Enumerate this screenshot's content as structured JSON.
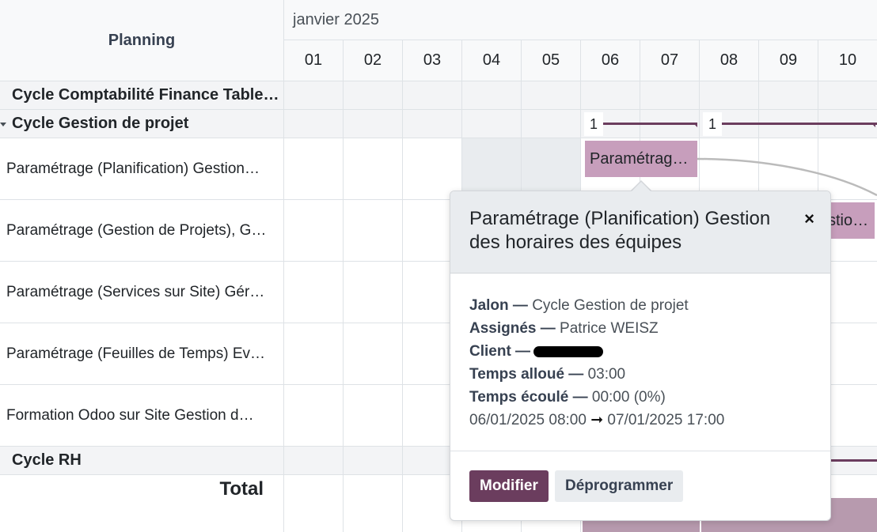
{
  "header": {
    "title": "Planning",
    "month": "janvier 2025",
    "days": [
      "01",
      "02",
      "03",
      "04",
      "05",
      "06",
      "07",
      "08",
      "09",
      "10"
    ]
  },
  "rows": {
    "group_finance": "Cycle Comptabilité Finance Table…",
    "group_project": "Cycle Gestion de projet",
    "tasks": [
      "Paramétrage (Planification) Gestion…",
      "Paramétrage (Gestion de Projets), G…",
      "Paramétrage (Services sur Site) Gér…",
      "Paramétrage (Feuilles de Temps) Ev…",
      "Formation Odoo sur Site Gestion d…"
    ],
    "group_rh": "Cycle RH",
    "total": "Total"
  },
  "pills": {
    "count_a": "1",
    "count_b": "1",
    "bar_1": "Paramétrag…",
    "bar_2": "stio…"
  },
  "popover": {
    "title": "Paramétrage (Planification) Gestion des horaires des équipes",
    "close_icon": "×",
    "milestone_label": "Jalon —",
    "milestone_value": "Cycle Gestion de projet",
    "assignees_label": "Assignés —",
    "assignees_value": "Patrice WEISZ",
    "client_label": "Client —",
    "allocated_label": "Temps alloué —",
    "allocated_value": "03:00",
    "elapsed_label": "Temps écoulé —",
    "elapsed_value": "00:00 (0%)",
    "date_start": "06/01/2025 08:00",
    "date_arrow": "➞",
    "date_end": "07/01/2025 17:00",
    "modify_button": "Modifier",
    "unschedule_button": "Déprogrammer"
  },
  "colors": {
    "accent": "#6b3d5e",
    "task_bar": "#c79ebc",
    "group_bg": "#f3f4f6"
  }
}
